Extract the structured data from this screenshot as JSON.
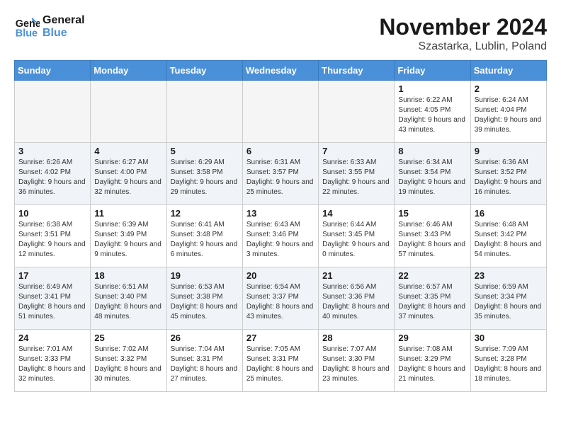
{
  "logo": {
    "line1": "General",
    "line2": "Blue"
  },
  "title": "November 2024",
  "subtitle": "Szastarka, Lublin, Poland",
  "days_of_week": [
    "Sunday",
    "Monday",
    "Tuesday",
    "Wednesday",
    "Thursday",
    "Friday",
    "Saturday"
  ],
  "weeks": [
    [
      {
        "day": "",
        "info": ""
      },
      {
        "day": "",
        "info": ""
      },
      {
        "day": "",
        "info": ""
      },
      {
        "day": "",
        "info": ""
      },
      {
        "day": "",
        "info": ""
      },
      {
        "day": "1",
        "info": "Sunrise: 6:22 AM\nSunset: 4:05 PM\nDaylight: 9 hours and 43 minutes."
      },
      {
        "day": "2",
        "info": "Sunrise: 6:24 AM\nSunset: 4:04 PM\nDaylight: 9 hours and 39 minutes."
      }
    ],
    [
      {
        "day": "3",
        "info": "Sunrise: 6:26 AM\nSunset: 4:02 PM\nDaylight: 9 hours and 36 minutes."
      },
      {
        "day": "4",
        "info": "Sunrise: 6:27 AM\nSunset: 4:00 PM\nDaylight: 9 hours and 32 minutes."
      },
      {
        "day": "5",
        "info": "Sunrise: 6:29 AM\nSunset: 3:58 PM\nDaylight: 9 hours and 29 minutes."
      },
      {
        "day": "6",
        "info": "Sunrise: 6:31 AM\nSunset: 3:57 PM\nDaylight: 9 hours and 25 minutes."
      },
      {
        "day": "7",
        "info": "Sunrise: 6:33 AM\nSunset: 3:55 PM\nDaylight: 9 hours and 22 minutes."
      },
      {
        "day": "8",
        "info": "Sunrise: 6:34 AM\nSunset: 3:54 PM\nDaylight: 9 hours and 19 minutes."
      },
      {
        "day": "9",
        "info": "Sunrise: 6:36 AM\nSunset: 3:52 PM\nDaylight: 9 hours and 16 minutes."
      }
    ],
    [
      {
        "day": "10",
        "info": "Sunrise: 6:38 AM\nSunset: 3:51 PM\nDaylight: 9 hours and 12 minutes."
      },
      {
        "day": "11",
        "info": "Sunrise: 6:39 AM\nSunset: 3:49 PM\nDaylight: 9 hours and 9 minutes."
      },
      {
        "day": "12",
        "info": "Sunrise: 6:41 AM\nSunset: 3:48 PM\nDaylight: 9 hours and 6 minutes."
      },
      {
        "day": "13",
        "info": "Sunrise: 6:43 AM\nSunset: 3:46 PM\nDaylight: 9 hours and 3 minutes."
      },
      {
        "day": "14",
        "info": "Sunrise: 6:44 AM\nSunset: 3:45 PM\nDaylight: 9 hours and 0 minutes."
      },
      {
        "day": "15",
        "info": "Sunrise: 6:46 AM\nSunset: 3:43 PM\nDaylight: 8 hours and 57 minutes."
      },
      {
        "day": "16",
        "info": "Sunrise: 6:48 AM\nSunset: 3:42 PM\nDaylight: 8 hours and 54 minutes."
      }
    ],
    [
      {
        "day": "17",
        "info": "Sunrise: 6:49 AM\nSunset: 3:41 PM\nDaylight: 8 hours and 51 minutes."
      },
      {
        "day": "18",
        "info": "Sunrise: 6:51 AM\nSunset: 3:40 PM\nDaylight: 8 hours and 48 minutes."
      },
      {
        "day": "19",
        "info": "Sunrise: 6:53 AM\nSunset: 3:38 PM\nDaylight: 8 hours and 45 minutes."
      },
      {
        "day": "20",
        "info": "Sunrise: 6:54 AM\nSunset: 3:37 PM\nDaylight: 8 hours and 43 minutes."
      },
      {
        "day": "21",
        "info": "Sunrise: 6:56 AM\nSunset: 3:36 PM\nDaylight: 8 hours and 40 minutes."
      },
      {
        "day": "22",
        "info": "Sunrise: 6:57 AM\nSunset: 3:35 PM\nDaylight: 8 hours and 37 minutes."
      },
      {
        "day": "23",
        "info": "Sunrise: 6:59 AM\nSunset: 3:34 PM\nDaylight: 8 hours and 35 minutes."
      }
    ],
    [
      {
        "day": "24",
        "info": "Sunrise: 7:01 AM\nSunset: 3:33 PM\nDaylight: 8 hours and 32 minutes."
      },
      {
        "day": "25",
        "info": "Sunrise: 7:02 AM\nSunset: 3:32 PM\nDaylight: 8 hours and 30 minutes."
      },
      {
        "day": "26",
        "info": "Sunrise: 7:04 AM\nSunset: 3:31 PM\nDaylight: 8 hours and 27 minutes."
      },
      {
        "day": "27",
        "info": "Sunrise: 7:05 AM\nSunset: 3:31 PM\nDaylight: 8 hours and 25 minutes."
      },
      {
        "day": "28",
        "info": "Sunrise: 7:07 AM\nSunset: 3:30 PM\nDaylight: 8 hours and 23 minutes."
      },
      {
        "day": "29",
        "info": "Sunrise: 7:08 AM\nSunset: 3:29 PM\nDaylight: 8 hours and 21 minutes."
      },
      {
        "day": "30",
        "info": "Sunrise: 7:09 AM\nSunset: 3:28 PM\nDaylight: 8 hours and 18 minutes."
      }
    ]
  ]
}
